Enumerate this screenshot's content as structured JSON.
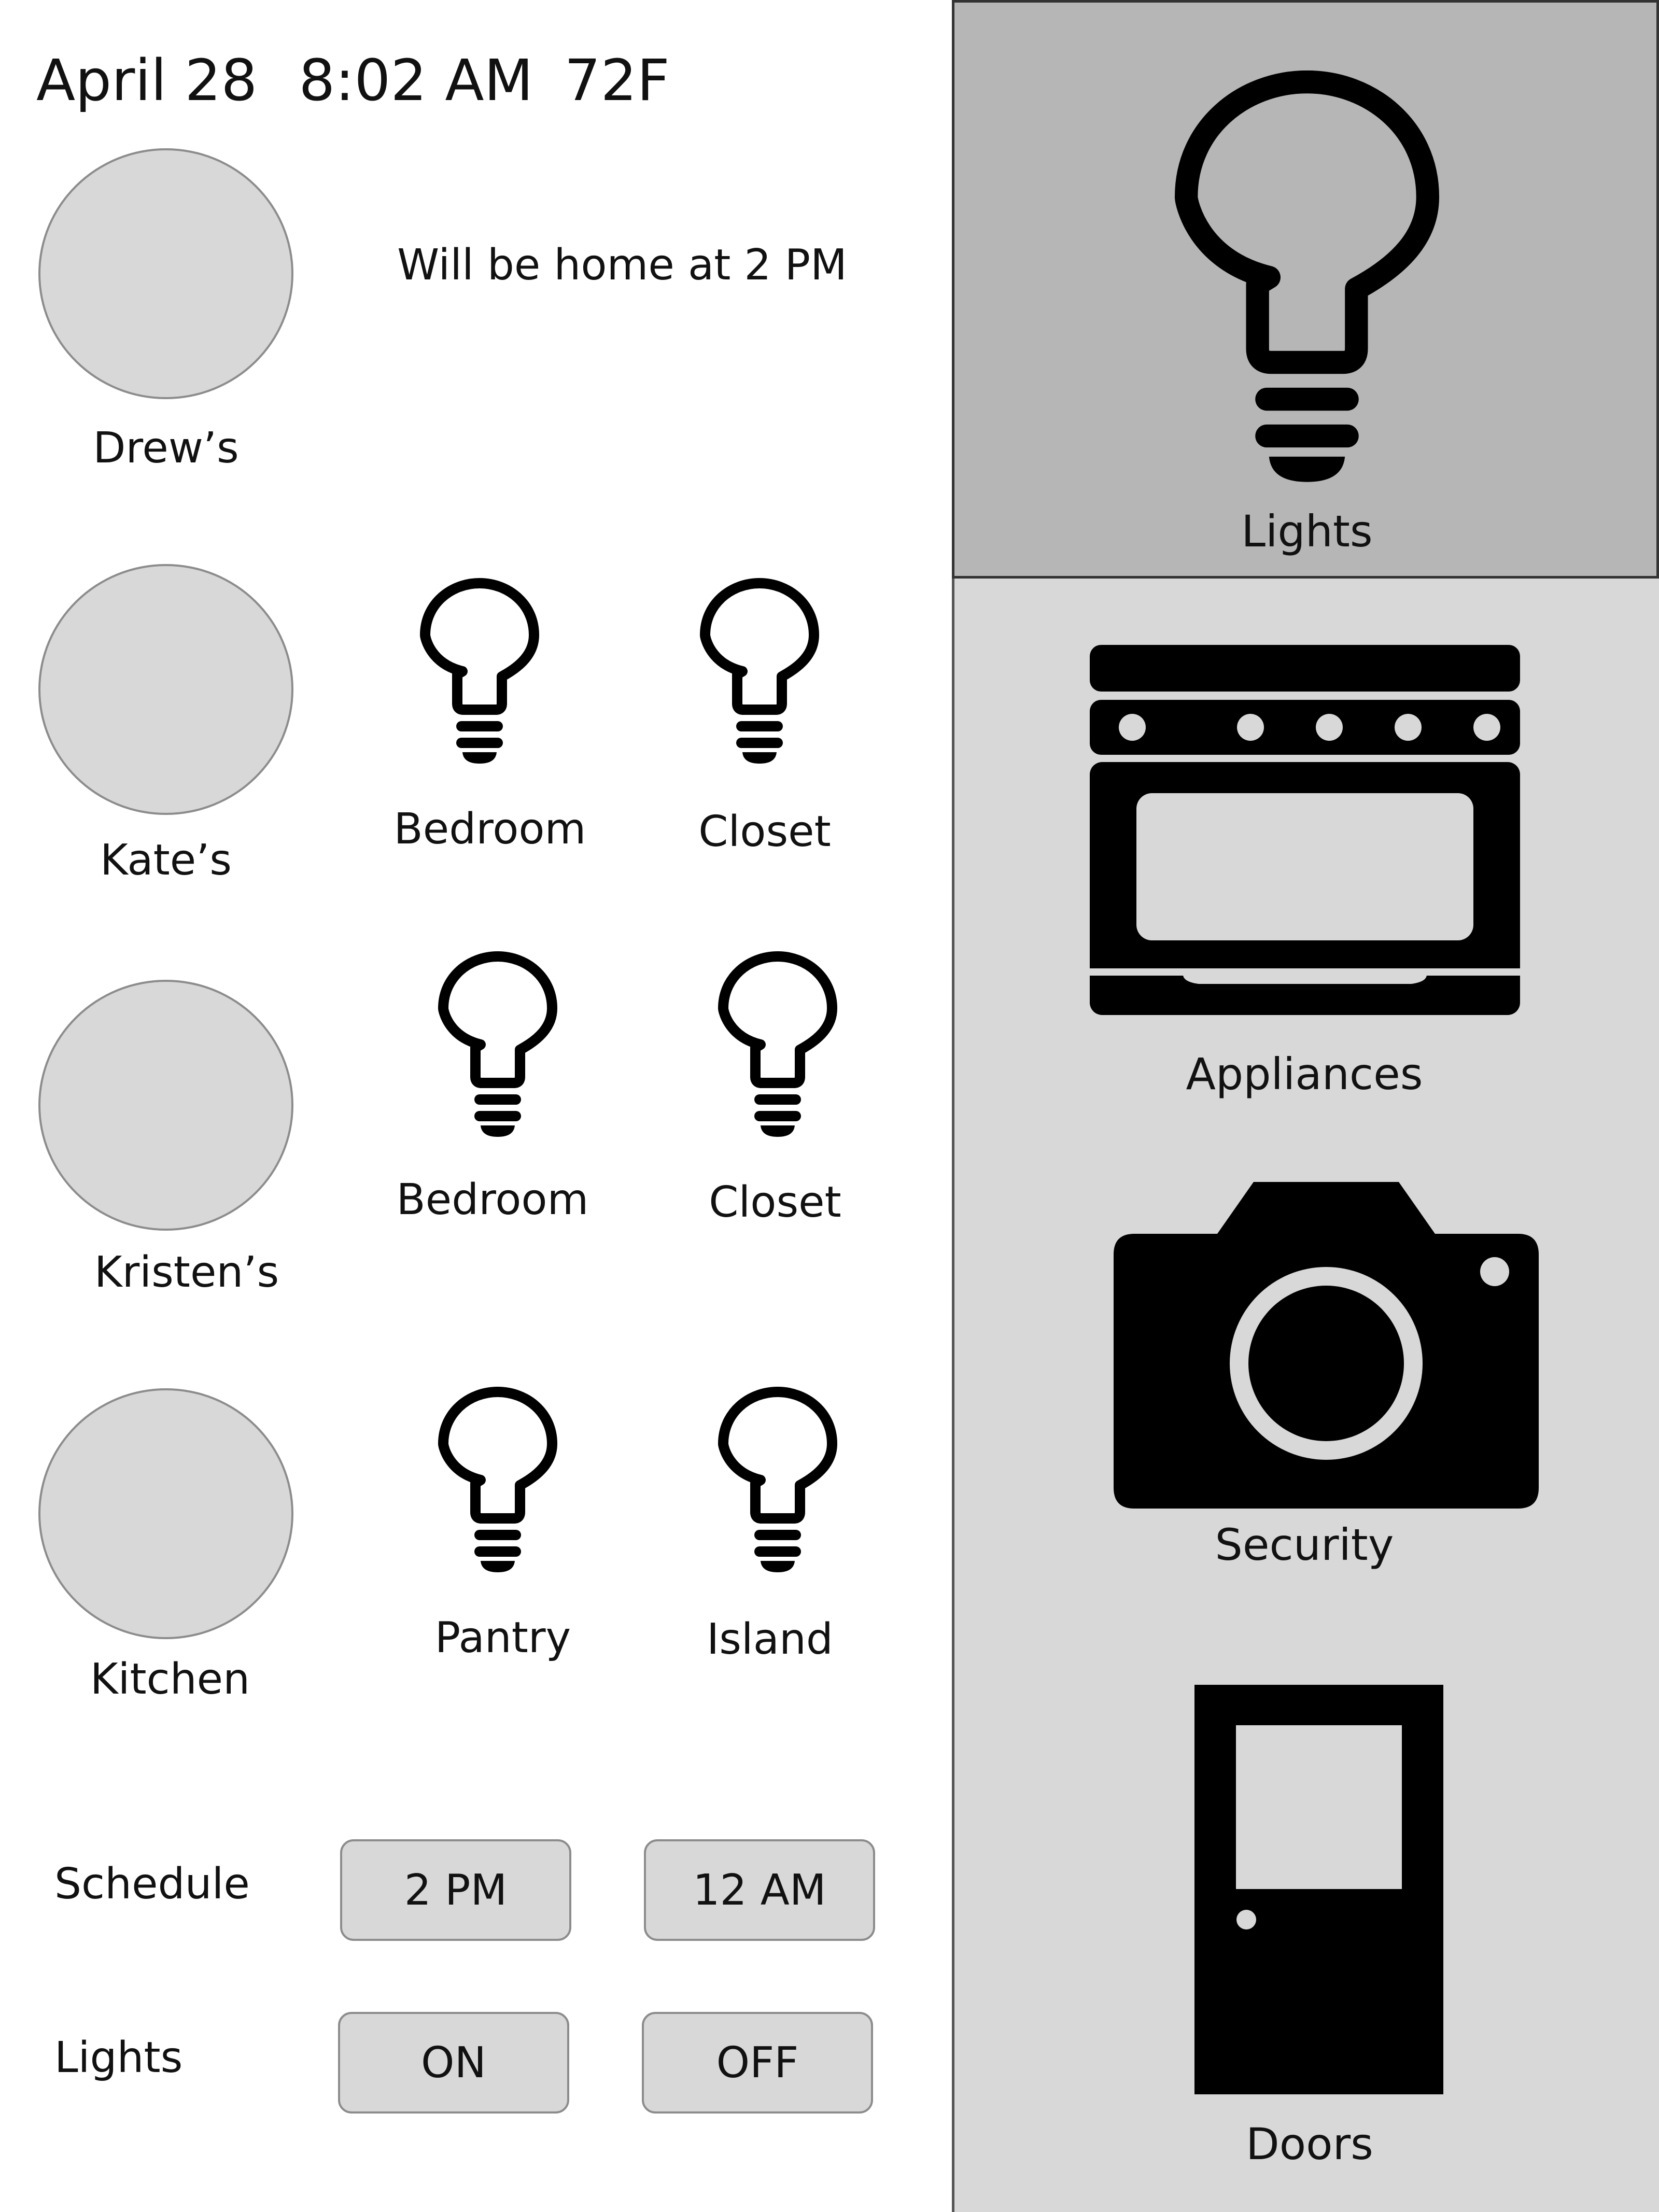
{
  "status": {
    "date": "April 28",
    "time": "8:02 AM",
    "temperature": "72F"
  },
  "rooms": [
    {
      "name": "Drew’s",
      "note": "Will be home at 2 PM",
      "lights": []
    },
    {
      "name": "Kate’s",
      "lights": [
        {
          "label": "Bedroom",
          "icon": "lightbulb-icon"
        },
        {
          "label": "Closet",
          "icon": "lightbulb-icon"
        }
      ]
    },
    {
      "name": "Kristen’s",
      "lights": [
        {
          "label": "Bedroom",
          "icon": "lightbulb-icon"
        },
        {
          "label": "Closet",
          "icon": "lightbulb-icon"
        }
      ]
    },
    {
      "name": "Kitchen",
      "lights": [
        {
          "label": "Pantry",
          "icon": "lightbulb-icon"
        },
        {
          "label": "Island",
          "icon": "lightbulb-icon"
        }
      ]
    }
  ],
  "controls": {
    "schedule": {
      "label": "Schedule",
      "options": [
        "2 PM",
        "12 AM"
      ]
    },
    "lights": {
      "label": "Lights",
      "options": [
        "ON",
        "OFF"
      ]
    }
  },
  "nav": [
    {
      "label": "Lights",
      "icon": "lightbulb-icon",
      "selected": true
    },
    {
      "label": "Appliances",
      "icon": "oven-icon",
      "selected": false
    },
    {
      "label": "Security",
      "icon": "camera-icon",
      "selected": false
    },
    {
      "label": "Doors",
      "icon": "door-icon",
      "selected": false
    }
  ],
  "colors": {
    "panel": "#d8d8d8",
    "selected": "#b6b6b6",
    "icon": "#000000",
    "border": "#8c8c8c"
  }
}
